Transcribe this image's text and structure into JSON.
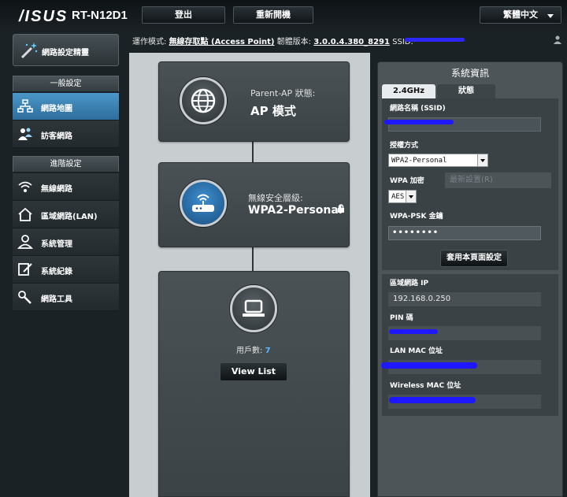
{
  "header": {
    "brand": "/ISUS",
    "model": "RT-N12D1",
    "logout_label": "登出",
    "reboot_label": "重新開機",
    "language_label": "繁體中文"
  },
  "status": {
    "mode_label": "運作模式:",
    "mode_value": "無線存取點 (Access Point)",
    "firmware_label": "韌體版本:",
    "firmware_value": "3.0.0.4.380_8291",
    "ssid_label": "SSID:"
  },
  "sidebar": {
    "qis_label": "網路設定精靈",
    "general_header": "一般設定",
    "general_items": [
      {
        "label": "網路地圖",
        "icon": "network-map-icon"
      },
      {
        "label": "訪客網路",
        "icon": "guest-network-icon"
      }
    ],
    "advanced_header": "進階設定",
    "advanced_items": [
      {
        "label": "無線網路",
        "icon": "wireless-icon"
      },
      {
        "label": "區域網路(LAN)",
        "icon": "lan-home-icon"
      },
      {
        "label": "系統管理",
        "icon": "admin-icon"
      },
      {
        "label": "系統紀錄",
        "icon": "system-log-icon"
      },
      {
        "label": "網路工具",
        "icon": "network-tools-icon"
      }
    ]
  },
  "map": {
    "parent_ap_label": "Parent-AP 狀態:",
    "parent_ap_value": "AP 模式",
    "security_label": "無線安全層級:",
    "security_value": "WPA2-Personal",
    "clients_label": "用戶數:",
    "clients_count": "7",
    "view_list_label": "View List"
  },
  "sysinfo": {
    "title": "系統資訊",
    "tabs": [
      "2.4GHz",
      "狀態"
    ],
    "ssid_label": "網路名稱 (SSID)",
    "auth_label": "授權方式",
    "auth_value": "WPA2-Personal",
    "wpa_enc_label": "WPA 加密",
    "wpa_enc_value": "AES",
    "psk_label": "WPA-PSK 金鑰",
    "psk_value": "••••••••",
    "apply_label": "套用本頁面設定",
    "ghost_text": "最新設置(R)",
    "lan_ip_label": "區域網路 IP",
    "lan_ip_value": "192.168.0.250",
    "pin_label": "PIN 碼",
    "lan_mac_label": "LAN MAC 位址",
    "wireless_mac_label": "Wireless MAC 位址"
  },
  "colors": {
    "accent_blue": "#4b97c8",
    "redaction": "#1f18ff",
    "client_count": "#5ab8ff"
  }
}
